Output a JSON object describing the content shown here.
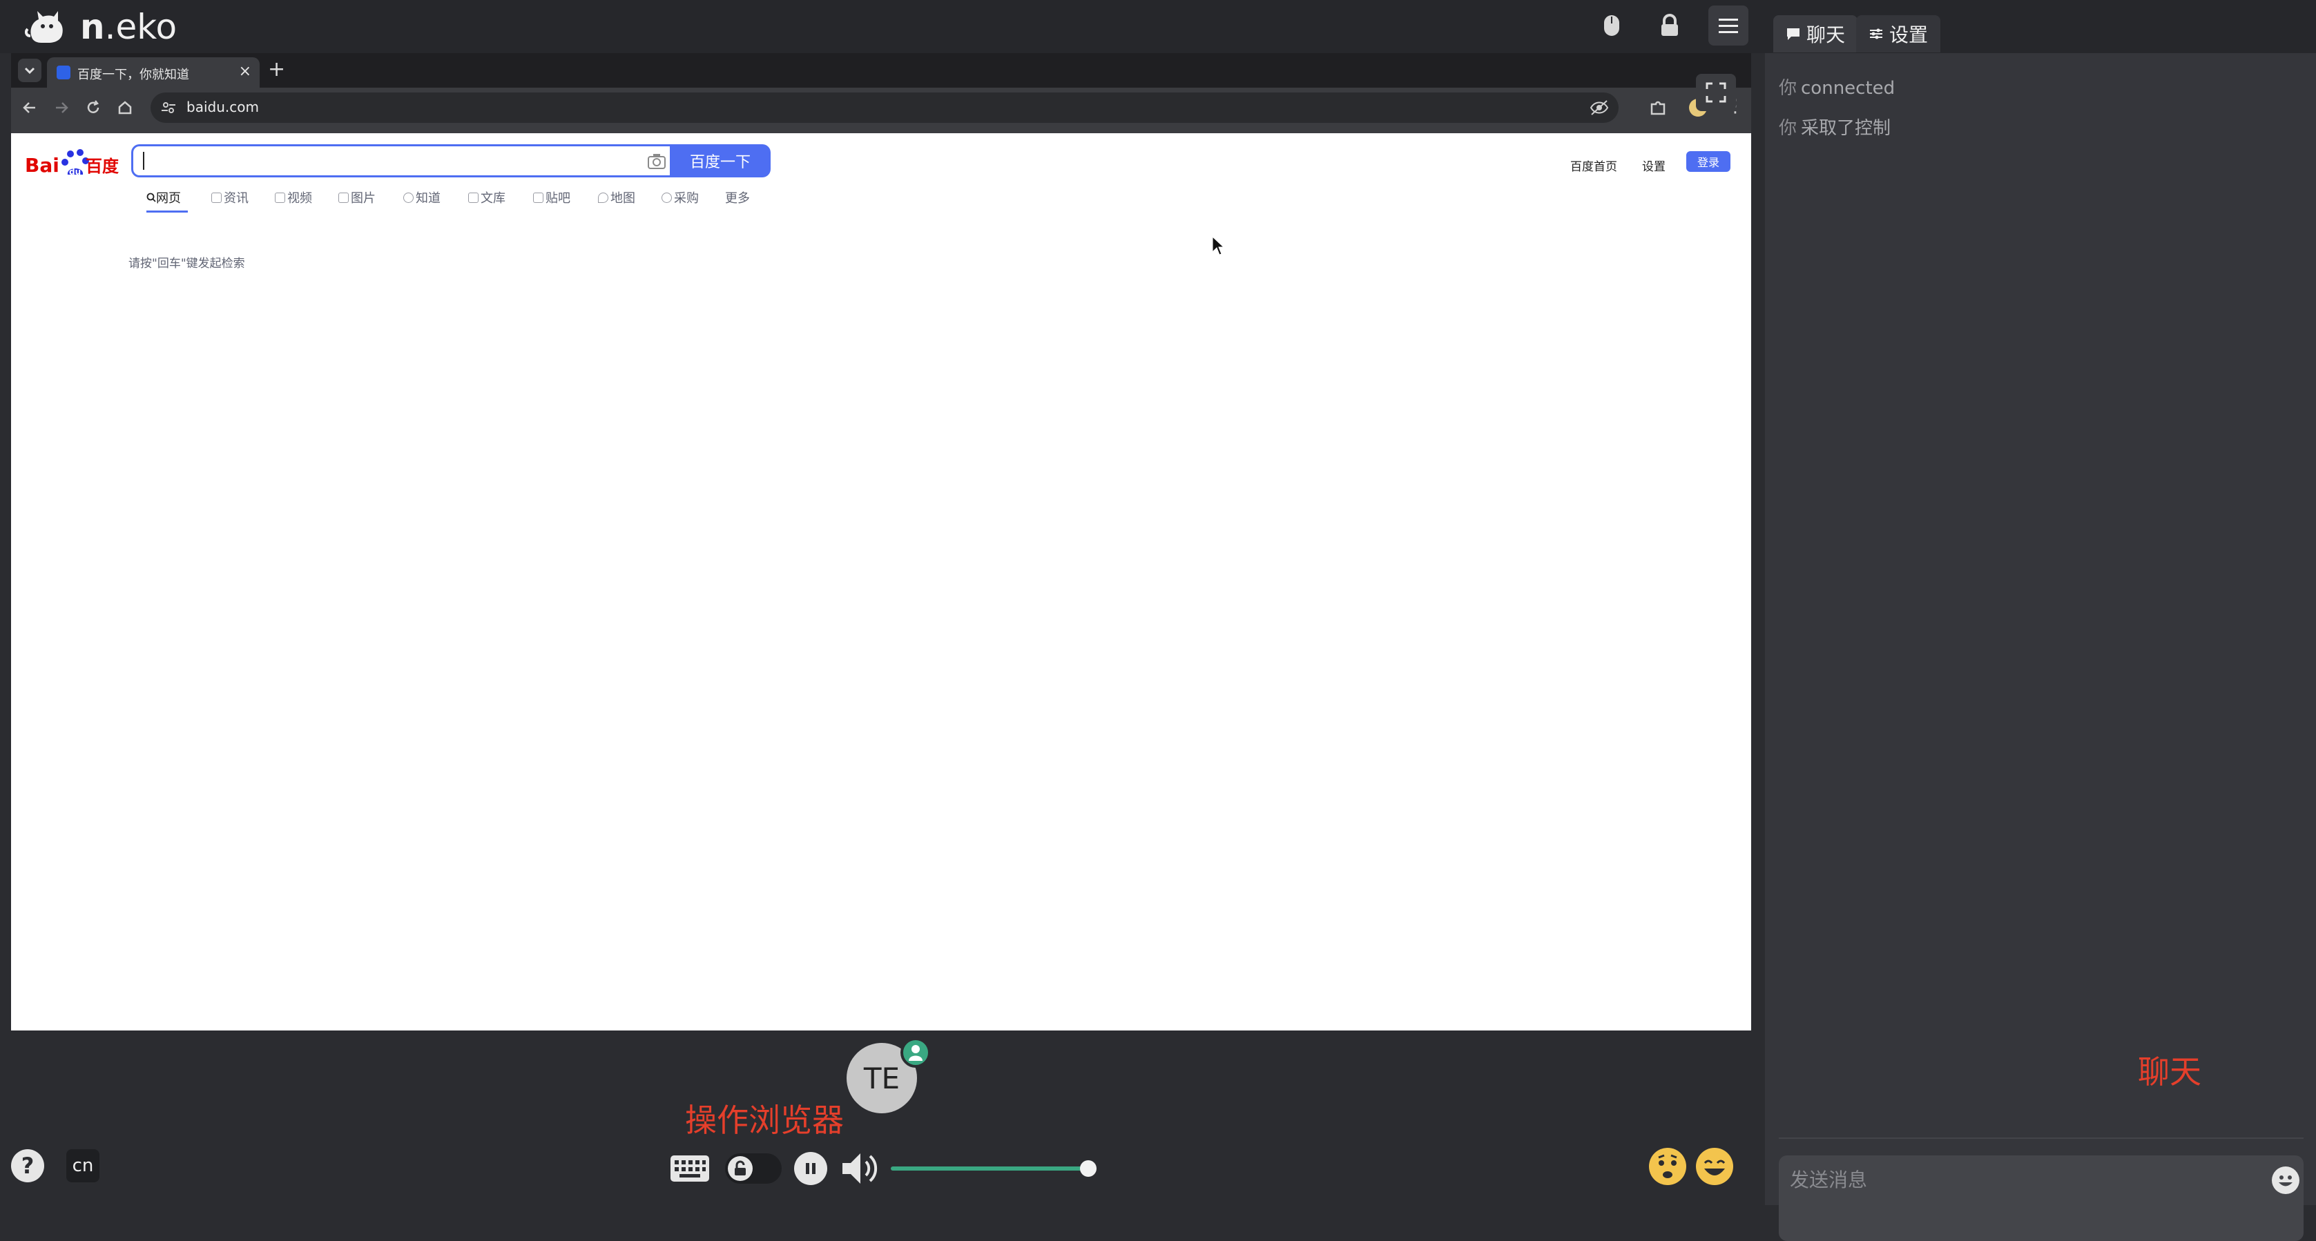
{
  "app": {
    "title_bold": "n",
    "title_rest": ".eko",
    "icons": [
      "mouse-icon",
      "lock-icon",
      "menu-icon"
    ]
  },
  "browser": {
    "tab": {
      "title": "百度一下，你就知道",
      "close": "×"
    },
    "new_tab": "+",
    "address": "baidu.com"
  },
  "baidu": {
    "logo_text": "Bai百度",
    "search_value": "",
    "search_button": "百度一下",
    "top_links": [
      "百度首页",
      "设置"
    ],
    "login": "登录",
    "tabs": [
      "网页",
      "资讯",
      "视频",
      "图片",
      "知道",
      "文库",
      "贴吧",
      "地图",
      "采购",
      "更多"
    ],
    "active_tab": "网页",
    "hint": "请按\"回车\"键发起检索"
  },
  "controls": {
    "help": "?",
    "lang": "cn",
    "member_initials": "TE",
    "annotation_browser": "操作浏览器",
    "volume_fraction": 1.0
  },
  "sidepanel": {
    "tabs": [
      {
        "label": "聊天",
        "icon": "chat-bubble-icon"
      },
      {
        "label": "设置",
        "icon": "sliders-icon"
      }
    ],
    "messages": [
      {
        "who": "你",
        "text": "connected"
      },
      {
        "who": "你",
        "text": "采取了控制"
      }
    ],
    "annotation_chat": "聊天",
    "chat_placeholder": "发送消息"
  },
  "colors": {
    "accent_green": "#3aa882",
    "baidu_blue": "#4e6ef2",
    "annotation_red": "#e53f2b"
  }
}
